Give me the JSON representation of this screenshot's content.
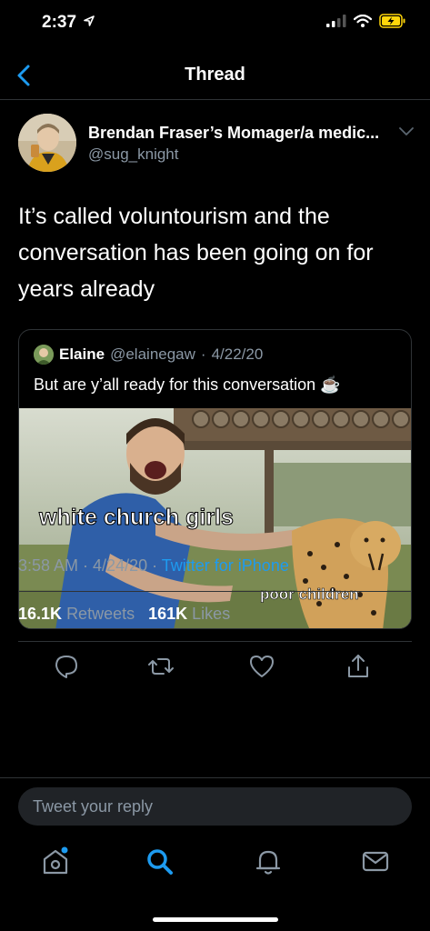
{
  "status_bar": {
    "time": "2:37",
    "location_icon": "location-arrow-icon",
    "signal_icon": "cellular-signal-icon",
    "wifi_icon": "wifi-icon",
    "battery_icon": "battery-charging-icon"
  },
  "nav": {
    "title": "Thread",
    "back_icon": "back-chevron-icon"
  },
  "tweet": {
    "author_name": "Brendan Fraser’s Momager/a medic...",
    "author_handle": "@sug_knight",
    "text": "It’s called voluntourism and the conversation has been going on for years already",
    "quote": {
      "name": "Elaine",
      "handle": "@elainegaw",
      "date": "4/22/20",
      "text": "But are y’all ready for this conversation",
      "emoji": "☕",
      "image_captions": [
        "white church girls",
        "poor children"
      ]
    },
    "time": "3:58 AM",
    "date": "4/24/20",
    "source": "Twitter for iPhone",
    "retweets": "16.1K",
    "retweets_label": "Retweets",
    "likes": "161K",
    "likes_label": "Likes"
  },
  "actions": [
    "reply-icon",
    "retweet-icon",
    "like-heart-icon",
    "share-icon"
  ],
  "reply_box": {
    "placeholder": "Tweet your reply"
  },
  "tabbar": [
    "home-icon",
    "search-icon",
    "notifications-bell-icon",
    "messages-envelope-icon"
  ],
  "colors": {
    "background": "#000000",
    "accent": "#1d9bf0",
    "secondary_text": "#8b98a5",
    "divider": "#2f3336"
  }
}
